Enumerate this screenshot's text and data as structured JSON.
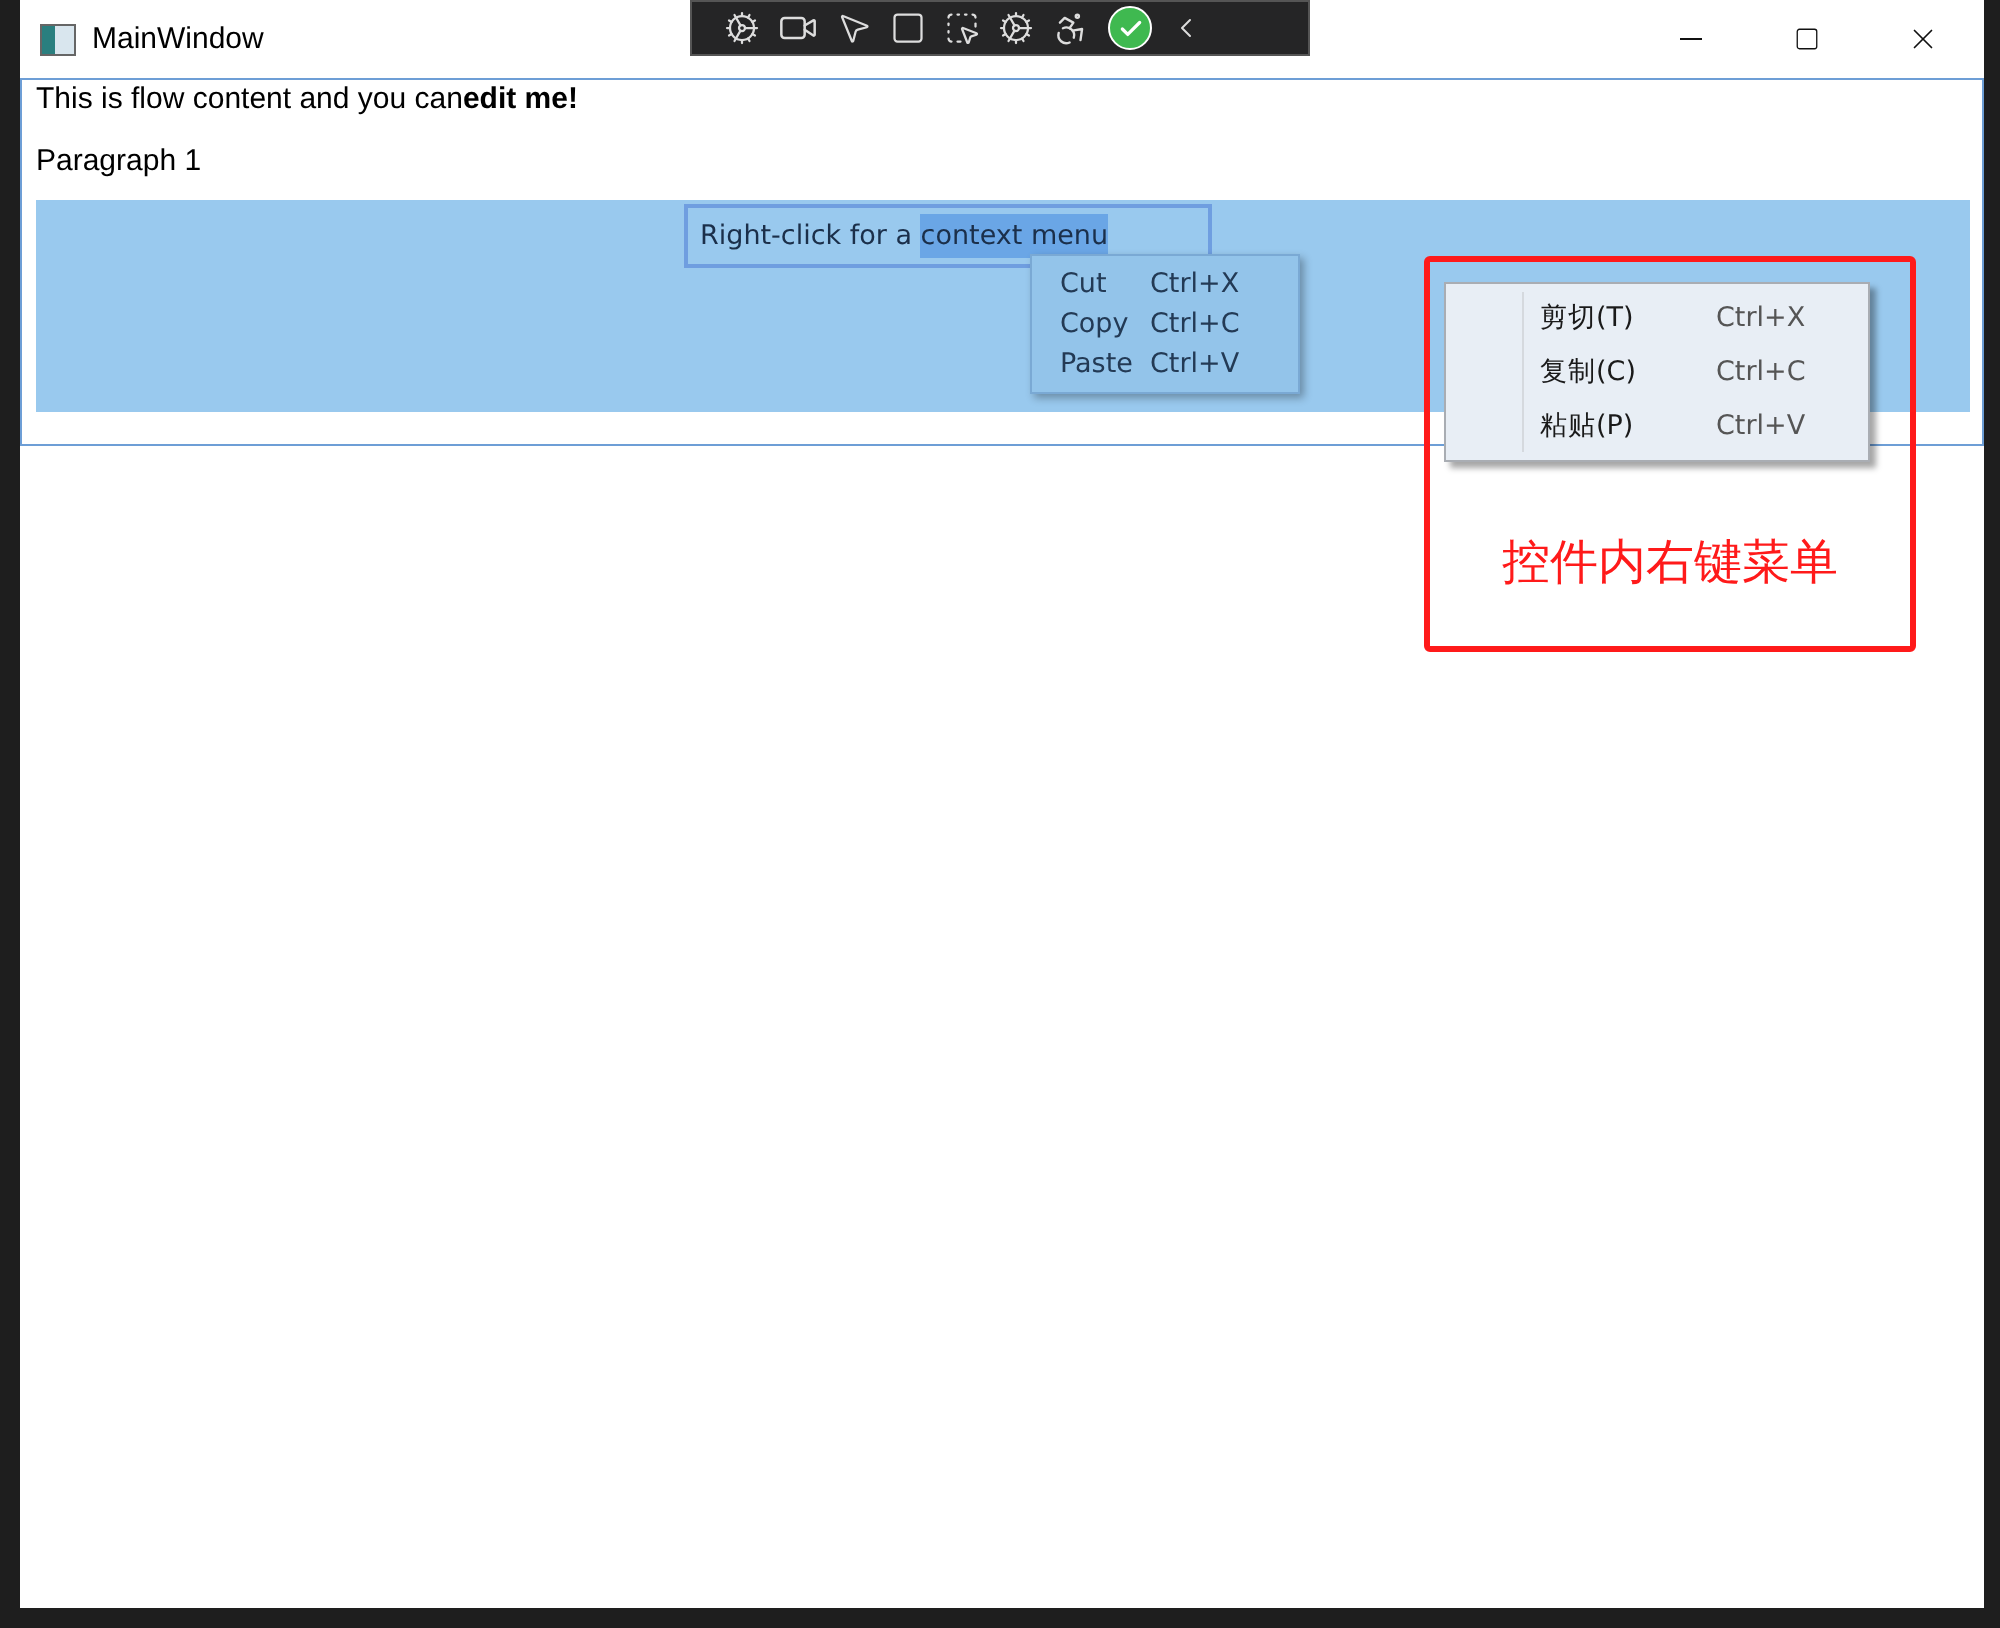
{
  "window": {
    "title": "MainWindow"
  },
  "document": {
    "paragraphs": [
      "This is flow content and you can**edit me!**",
      "Paragraph 1"
    ]
  },
  "textbox": {
    "segments": [
      {
        "text": "Right-click for a ",
        "selected": false
      },
      {
        "text": "context menu",
        "selected": true
      }
    ]
  },
  "context_menu": {
    "items": [
      {
        "label": "Cut",
        "shortcut": "Ctrl+X"
      },
      {
        "label": "Copy",
        "shortcut": "Ctrl+C"
      },
      {
        "label": "Paste",
        "shortcut": "Ctrl+V"
      }
    ]
  },
  "system_menu": {
    "items": [
      {
        "label": "剪切(T)",
        "shortcut": "Ctrl+X"
      },
      {
        "label": "复制(C)",
        "shortcut": "Ctrl+C"
      },
      {
        "label": "粘贴(P)",
        "shortcut": "Ctrl+V"
      }
    ]
  },
  "annotation": {
    "text": "控件内右键菜单"
  }
}
